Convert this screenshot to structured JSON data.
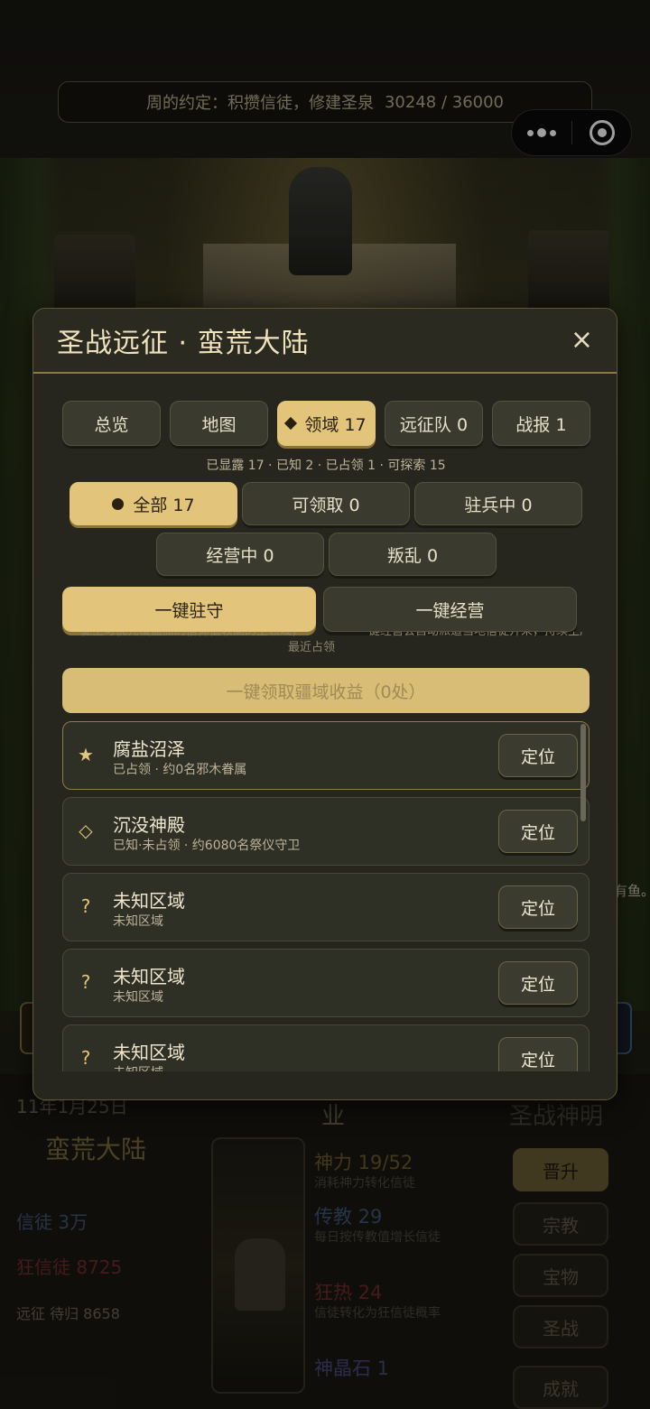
{
  "banner": {
    "label": "周的约定：积攒信徒，修建圣泉",
    "progress": "30248 / 36000"
  },
  "scene": {
    "side_text": "有鱼。"
  },
  "bottom_panel": {
    "date": "11年1月25日",
    "region": "蛮荒大陆",
    "followers": "信徒 3万",
    "zealots": "狂信徒 8725",
    "expedition": "远征 待归 8658",
    "middle_title": "业",
    "stats": [
      {
        "value": "神力 19/52",
        "desc": "消耗神力转化信徒",
        "color": "#6d5a2c"
      },
      {
        "value": "传教 29",
        "desc": "每日按传教值增长信徒",
        "color": "#3e5472"
      },
      {
        "value": "狂热 24",
        "desc": "信徒转化为狂信徒概率",
        "color": "#6e2c2a"
      },
      {
        "value": "神晶石 1",
        "desc": "",
        "color": "#48477a"
      }
    ],
    "right_title": "圣战神明",
    "side_buttons": [
      "晋升",
      "宗教",
      "宝物",
      "圣战",
      "成就"
    ]
  },
  "modal": {
    "title": "圣战远征 · 蛮荒大陆",
    "close_glyph": "×",
    "tabs": [
      {
        "label": "总览",
        "active": false
      },
      {
        "label": "地图",
        "active": false
      },
      {
        "label": "领域 17",
        "active": true
      },
      {
        "label": "远征队 0",
        "active": false
      },
      {
        "label": "战报 1",
        "active": false
      }
    ],
    "summary": "已显露 17 · 已知 2 · 已占领 1 · 可探索 15",
    "filters": [
      {
        "label": "全部 17",
        "active": true
      },
      {
        "label": "可领取 0",
        "active": false
      },
      {
        "label": "驻兵中 0",
        "active": false
      },
      {
        "label": "经营中 0",
        "active": false
      },
      {
        "label": "叛乱 0",
        "active": false
      }
    ],
    "actions": {
      "garrison": "一键驻守",
      "manage": "一键经营"
    },
    "hint_left": "徒生可优先覆盖旅的信仰值较高的主领域，",
    "hint_right": "一键经营会自动派遣当地信徒开采，持续生产",
    "hint_line2": "最近占领",
    "claim_label": "一键领取疆域收益（0处）",
    "locate_label": "定位",
    "territories": [
      {
        "icon": "★",
        "icon_name": "star-icon",
        "name": "腐盐沼泽",
        "status": "已占领 · 约0名邪木眷属",
        "occupied": true
      },
      {
        "icon": "◇",
        "icon_name": "diamond-outline-icon",
        "name": "沉没神殿",
        "status": "已知·未占领 · 约6080名祭仪守卫",
        "occupied": false
      },
      {
        "icon": "?",
        "icon_name": "question-icon",
        "name": "未知区域",
        "status": "未知区域",
        "occupied": false
      },
      {
        "icon": "?",
        "icon_name": "question-icon",
        "name": "未知区域",
        "status": "未知区域",
        "occupied": false
      },
      {
        "icon": "?",
        "icon_name": "question-icon",
        "name": "未知区域",
        "status": "未知区域",
        "occupied": false
      }
    ]
  }
}
